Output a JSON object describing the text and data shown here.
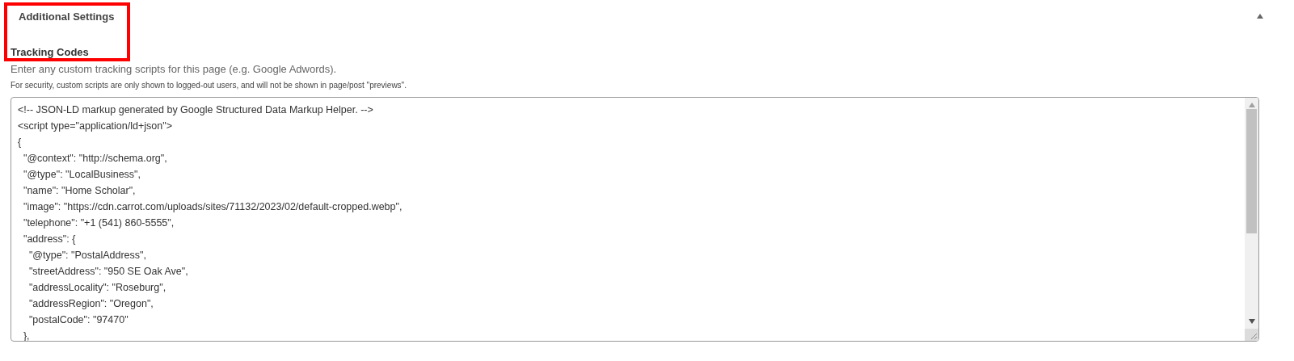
{
  "section": {
    "title": "Additional Settings",
    "expanded": true
  },
  "field": {
    "label": "Tracking Codes",
    "description": "Enter any custom tracking scripts for this page (e.g. Google Adwords).",
    "note": "For security, custom scripts are only shown to logged-out users, and will not be shown in page/post \"previews\".",
    "code_lines": [
      "<!-- JSON-LD markup generated by Google Structured Data Markup Helper. -->",
      "<script type=\"application/ld+json\">",
      "{",
      "  \"@context\": \"http://schema.org\",",
      "  \"@type\": \"LocalBusiness\",",
      "  \"name\": \"Home Scholar\",",
      "  \"image\": \"https://cdn.carrot.com/uploads/sites/71132/2023/02/default-cropped.webp\",",
      "  \"telephone\": \"+1 (541) 860-5555\",",
      "  \"address\": {",
      "    \"@type\": \"PostalAddress\",",
      "    \"streetAddress\": \"950 SE Oak Ave\",",
      "    \"addressLocality\": \"Roseburg\",",
      "    \"addressRegion\": \"Oregon\",",
      "    \"postalCode\": \"97470\"",
      "  },"
    ]
  }
}
